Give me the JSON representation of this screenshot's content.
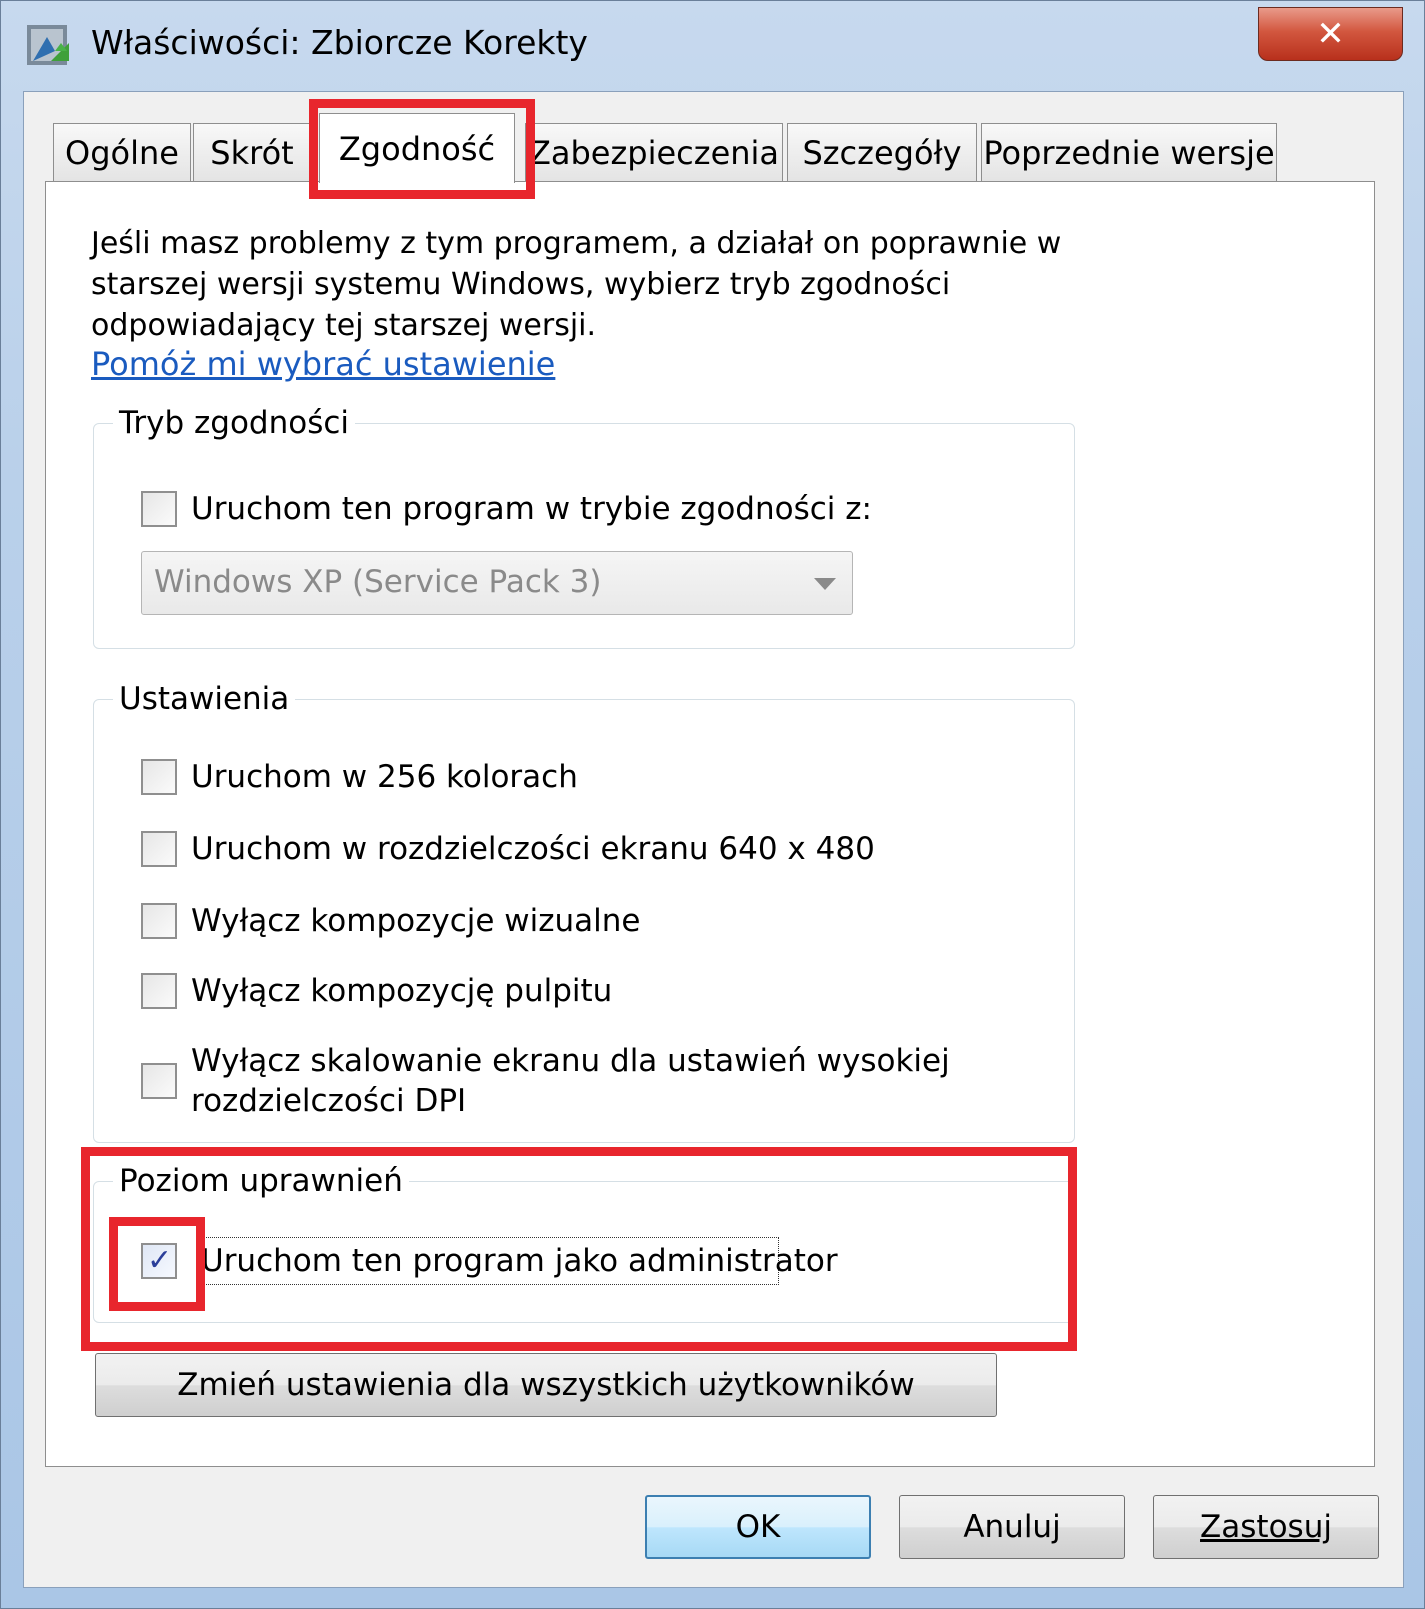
{
  "window": {
    "title": "Właściwości: Zbiorcze Korekty",
    "close_glyph": "✕"
  },
  "tabs": [
    {
      "label": "Ogólne"
    },
    {
      "label": "Skrót"
    },
    {
      "label": "Zgodność"
    },
    {
      "label": "Zabezpieczenia"
    },
    {
      "label": "Szczegóły"
    },
    {
      "label": "Poprzednie wersje"
    }
  ],
  "active_tab": "Zgodność",
  "intro": {
    "text": "Jeśli masz problemy z tym programem, a działał on poprawnie w starszej wersji systemu Windows, wybierz tryb zgodności odpowiadający tej starszej wersji.",
    "link": "Pomóż mi wybrać ustawienie"
  },
  "compat_group": {
    "legend": "Tryb zgodności",
    "checkbox_label": "Uruchom ten program w trybie zgodności z:",
    "checked": false,
    "select_value": "Windows XP (Service Pack 3)"
  },
  "settings_group": {
    "legend": "Ustawienia",
    "options": [
      {
        "label": "Uruchom w 256 kolorach",
        "checked": false
      },
      {
        "label": "Uruchom w rozdzielczości ekranu 640 x 480",
        "checked": false
      },
      {
        "label": "Wyłącz kompozycje wizualne",
        "checked": false
      },
      {
        "label": "Wyłącz kompozycję pulpitu",
        "checked": false
      },
      {
        "label": "Wyłącz skalowanie ekranu dla ustawień wysokiej",
        "label_line2": "rozdzielczości DPI",
        "checked": false
      }
    ]
  },
  "privilege_group": {
    "legend": "Poziom uprawnień",
    "checkbox_label": "Uruchom ten program jako administrator",
    "checked": true,
    "check_glyph": "✓"
  },
  "change_all_button": "Zmień ustawienia dla wszystkich użytkowników",
  "dialog_buttons": {
    "ok": "OK",
    "cancel": "Anuluj",
    "apply": "Zastosuj"
  },
  "colors": {
    "highlight": "#e8262d",
    "link": "#1a5bbf",
    "close_button": "#c8442c"
  }
}
